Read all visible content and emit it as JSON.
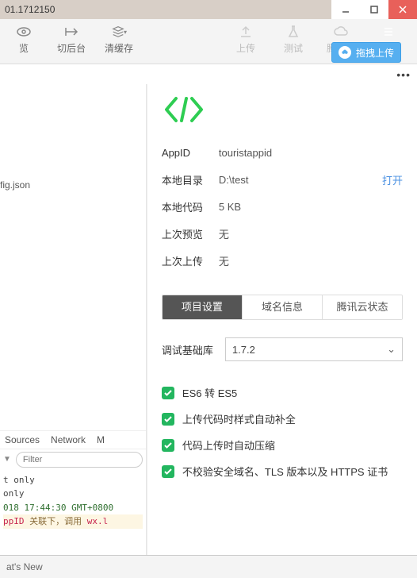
{
  "window": {
    "title": "01.1712150"
  },
  "titlebar_buttons": {
    "min": "minimize",
    "max": "maximize",
    "close": "close"
  },
  "drag_upload": {
    "label": "拖拽上传",
    "icon": "cloud-disk"
  },
  "toolbar": {
    "preview": "览",
    "toggle_back": "切后台",
    "clear_cache": "清缓存",
    "upload": "上传",
    "test": "测试",
    "tencent_cloud": "腾讯云",
    "details": "详情",
    "ellipsis": "•••"
  },
  "tree": {
    "file": "fig.json"
  },
  "devtools": {
    "tab_sources": "Sources",
    "tab_network": "Network",
    "tab_m": "M",
    "filter_placeholder": "Filter"
  },
  "console": {
    "line1": "t only",
    "line2": "only",
    "line3": "018 17:44:30 GMT+0800",
    "line4_a": "ppID",
    "line4_b": " 关联下，调用 ",
    "line4_c": "wx.l"
  },
  "whats_new": "at's New",
  "project": {
    "appid_label": "AppID",
    "appid_value": "touristappid",
    "local_dir_label": "本地目录",
    "local_dir_value": "D:\\test",
    "open_label": "打开",
    "local_code_label": "本地代码",
    "local_code_value": "5 KB",
    "last_preview_label": "上次预览",
    "last_preview_value": "无",
    "last_upload_label": "上次上传",
    "last_upload_value": "无"
  },
  "panel_tabs": {
    "settings": "项目设置",
    "domain": "域名信息",
    "cloud_status": "腾讯云状态"
  },
  "settings": {
    "base_lib_label": "调试基础库",
    "base_lib_value": "1.7.2",
    "check_es6": "ES6 转 ES5",
    "check_style": "上传代码时样式自动补全",
    "check_compress": "代码上传时自动压缩",
    "check_nocheck": "不校验安全域名、TLS 版本以及 HTTPS 证书"
  }
}
